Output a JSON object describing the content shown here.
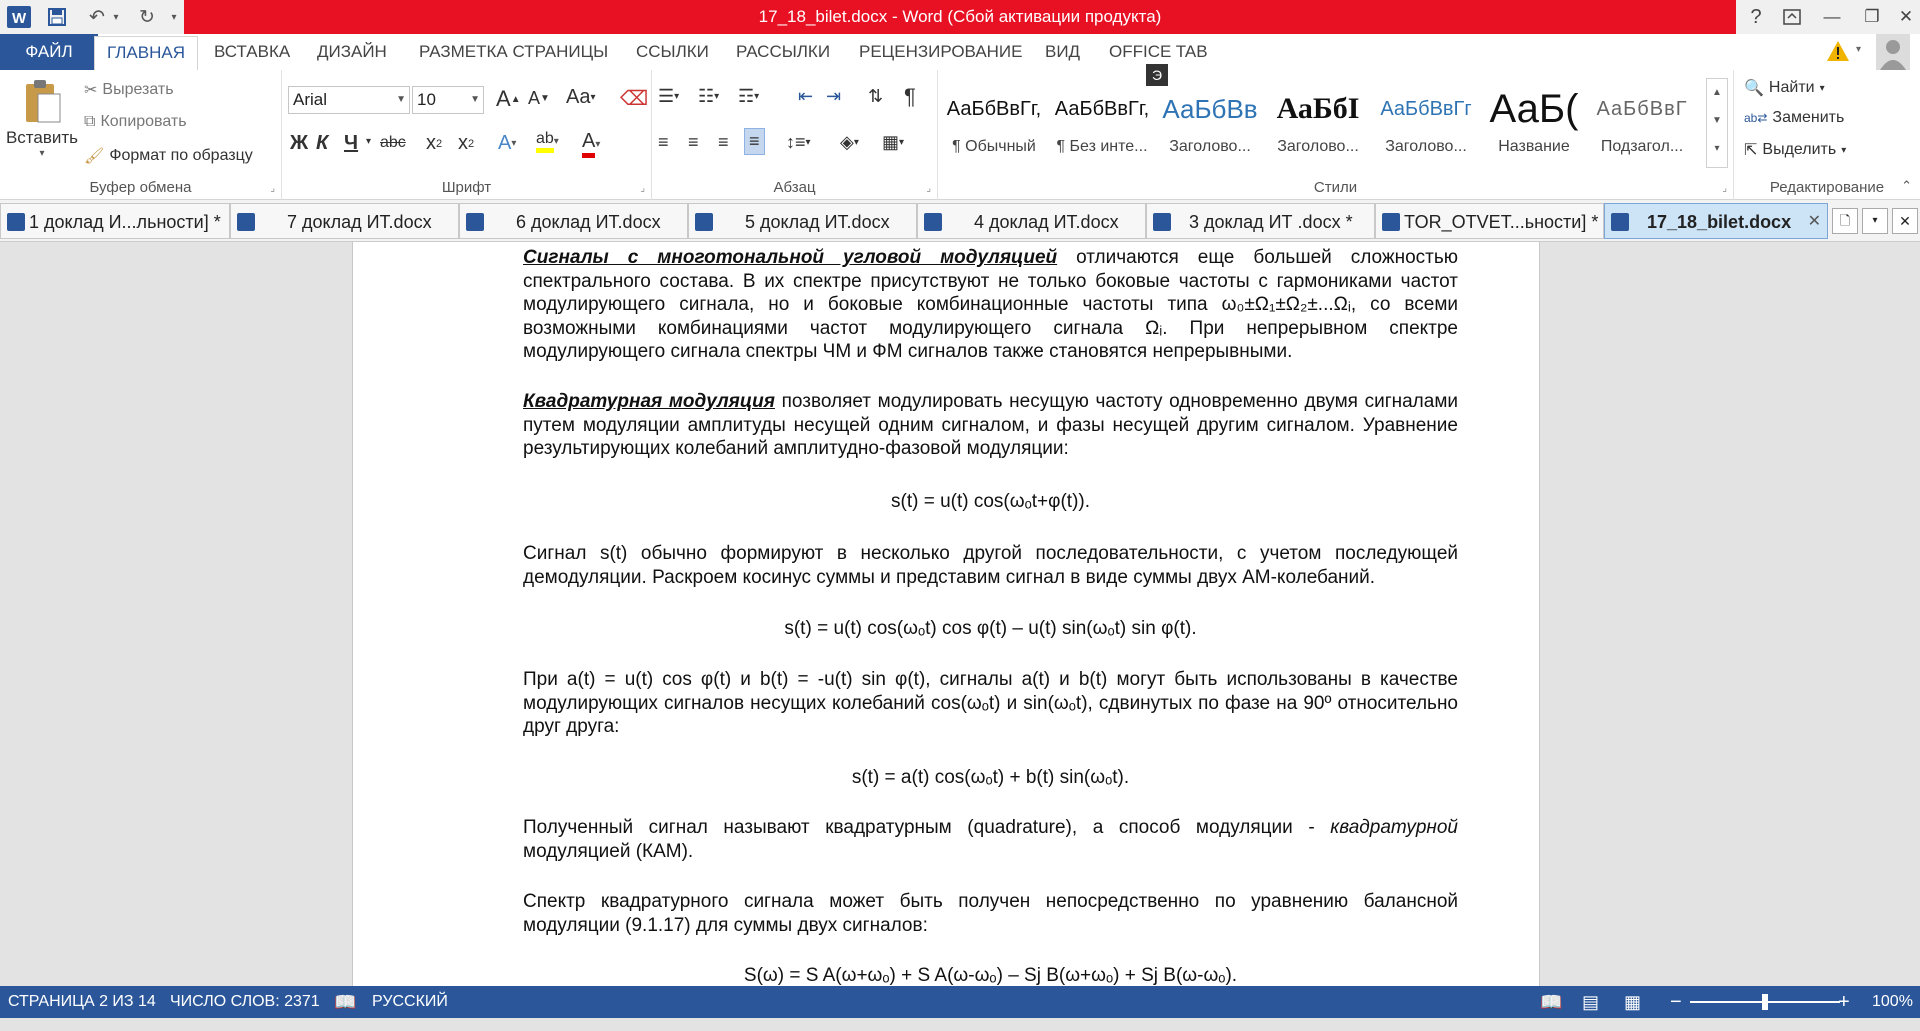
{
  "window": {
    "title": "17_18_bilet.docx - Word (Сбой активации продукта)"
  },
  "ribbon_tabs": [
    "ФАЙЛ",
    "ГЛАВНАЯ",
    "ВСТАВКА",
    "ДИЗАЙН",
    "РАЗМЕТКА СТРАНИЦЫ",
    "ССЫЛКИ",
    "РАССЫЛКИ",
    "РЕЦЕНЗИРОВАНИЕ",
    "ВИД",
    "OFFICE TAB"
  ],
  "clipboard": {
    "paste": "Вставить",
    "cut": "Вырезать",
    "copy": "Копировать",
    "format_painter": "Формат по образцу",
    "label": "Буфер обмена"
  },
  "font": {
    "name": "Arial",
    "size": "10",
    "label": "Шрифт",
    "case_btn": "Aa",
    "bold": "Ж",
    "italic": "К",
    "underline": "Ч",
    "strike": "abc"
  },
  "paragraph": {
    "label": "Абзац"
  },
  "styles": {
    "label": "Стили",
    "items": [
      {
        "preview": "АаБбВвГг,",
        "name": "¶ Обычный"
      },
      {
        "preview": "АаБбВвГг,",
        "name": "¶ Без инте..."
      },
      {
        "preview": "АаБбВв",
        "name": "Заголово..."
      },
      {
        "preview": "АаБбI",
        "name": "Заголово..."
      },
      {
        "preview": "АаБбВвГг",
        "name": "Заголово..."
      },
      {
        "preview": "АаБ(",
        "name": "Название"
      },
      {
        "preview": "АаБбВвГ",
        "name": "Подзагол..."
      }
    ]
  },
  "editing": {
    "find": "Найти",
    "replace": "Заменить",
    "select": "Выделить",
    "label": "Редактирование"
  },
  "key_tip": "Э",
  "doc_tabs": [
    "1 доклад И...льности] *",
    "7 доклад ИТ.docx",
    "6 доклад ИТ.docx",
    "5 доклад ИТ.docx",
    "4 доклад ИТ.docx",
    "3 доклад ИТ .docx *",
    "TOR_OTVET...ьности] *",
    "17_18_bilet.docx"
  ],
  "doc": {
    "p1_lead": "Сигналы с многотональной угловой модуляцией",
    "p1_rest": " отличаются еще большей сложностью спектрального состава. В их спектре присутствуют не только боковые частоты с гармониками частот модулирующего сигнала, но и боковые комбинационные частоты типа ω₀±Ω₁±Ω₂±...Ωᵢ, со всеми возможными комбинациями частот модулирующего сигнала Ωᵢ. При непрерывном спектре модулирующего сигнала спектры ЧМ и ФМ сигналов также становятся непрерывными.",
    "p2_lead": "Квадратурная модуляция",
    "p2_rest": " позволяет модулировать несущую частоту одновременно двумя сигналами путем модуляции амплитуды несущей одним сигналом, и фазы несущей другим сигналом. Уравнение результирующих колебаний амплитудно-фазовой модуляции:",
    "eq1": "s(t) = u(t) cos(ωₒt+φ(t)).",
    "p3": "Сигнал s(t) обычно формируют в несколько другой последовательности, с учетом последующей демодуляции. Раскроем косинус суммы и представим сигнал в виде суммы двух АМ-колебаний.",
    "eq2": "s(t) = u(t) cos(ωₒt) cos φ(t) – u(t) sin(ωₒt) sin φ(t).",
    "p4": "При a(t) = u(t) cos φ(t) и b(t) = -u(t) sin φ(t), сигналы a(t) и b(t) могут быть использованы в качестве модулирующих сигналов несущих колебаний cos(ωₒt) и sin(ωₒt), сдвинутых по фазе на 90º относительно друг друга:",
    "eq3": "s(t) = a(t) cos(ωₒt) + b(t) sin(ωₒt).",
    "p5_a": "Полученный сигнал называют квадратурным (quadrature), а способ модуляции - ",
    "p5_b": "квадратурной",
    "p5_c": " модуляцией (КАМ).",
    "p6": "Спектр квадратурного сигнала может быть получен непосредственно по уравнению балансной модуляции (9.1.17) для суммы двух сигналов:",
    "eq4": "S(ω) = S A(ω+ωₒ) + S A(ω-ωₒ) – Sj B(ω+ωₒ) + Sj B(ω-ωₒ)."
  },
  "status": {
    "page": "СТРАНИЦА 2 ИЗ 14",
    "words": "ЧИСЛО СЛОВ: 2371",
    "lang": "РУССКИЙ",
    "zoom": "100%",
    "zoom_level": 1.0
  },
  "colors": {
    "accent": "#2b579a",
    "title_bar": "#e81123"
  }
}
